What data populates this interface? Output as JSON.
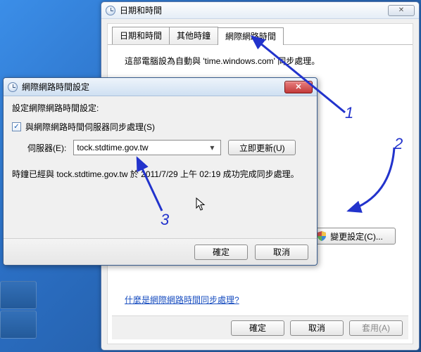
{
  "back": {
    "title": "日期和時間",
    "tabs": [
      {
        "label": "日期和時間"
      },
      {
        "label": "其他時鐘"
      },
      {
        "label": "網際網路時間"
      }
    ],
    "syncDescription": "這部電腦設為自動與 'time.windows.com' 同步處理。",
    "changeSettingsLabel": "變更設定(C)...",
    "helpLink": "什麼是網際網路時間同步處理?",
    "ok": "確定",
    "cancel": "取消",
    "apply": "套用(A)"
  },
  "front": {
    "title": "網際網路時間設定",
    "heading": "設定網際網路時間設定:",
    "checkboxLabel": "與網際網路時間伺服器同步處理(S)",
    "checkboxChecked": true,
    "serverLabel": "伺服器(E):",
    "serverValue": "tock.stdtime.gov.tw",
    "updateNow": "立即更新(U)",
    "status": "時鐘已經與 tock.stdtime.gov.tw 於 2011/7/29 上午 02:19 成功完成同步處理。",
    "ok": "確定",
    "cancel": "取消"
  },
  "annotations": {
    "n1": "1",
    "n2": "2",
    "n3": "3"
  }
}
